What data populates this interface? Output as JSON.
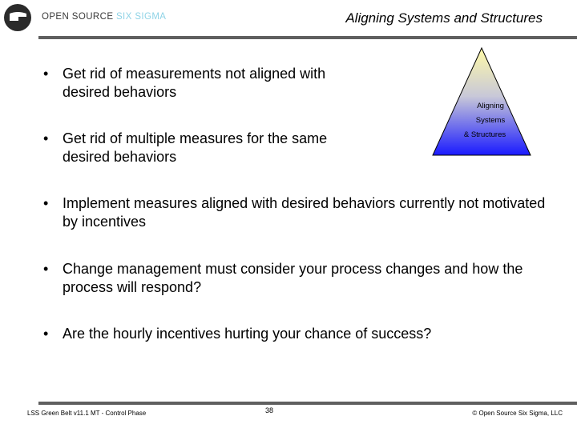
{
  "header": {
    "logo": {
      "icon": "open-source-six-sigma-logo-icon",
      "text_primary": "OPEN SOURCE ",
      "text_accent": "SIX SIGMA",
      "accent_color": "#8fd3e6"
    },
    "title": "Aligning Systems and Structures"
  },
  "bullets": [
    {
      "text": "Get rid of measurements not aligned with desired behaviors"
    },
    {
      "text": "Get rid of multiple measures for the same desired behaviors"
    },
    {
      "text": "Implement measures aligned with desired behaviors currently not motivated by incentives"
    },
    {
      "text": "Change management must consider your process changes and how the process will respond?"
    },
    {
      "text": "Are the hourly incentives hurting your chance of success?"
    }
  ],
  "bullet_symbol": "•",
  "pyramid": {
    "lines": [
      "Aligning",
      "Systems",
      "& Structures"
    ],
    "gradient_top": "#fffaa8",
    "gradient_bottom": "#1a1aff"
  },
  "footer": {
    "left": "LSS Green Belt v11.1 MT - Control Phase",
    "page": "38",
    "right": "©  Open Source Six Sigma, LLC"
  }
}
